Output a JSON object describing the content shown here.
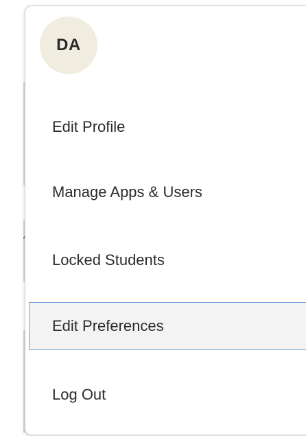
{
  "avatar": {
    "initials": "DA"
  },
  "menu": {
    "items": [
      {
        "label": "Edit Profile"
      },
      {
        "label": "Manage Apps & Users"
      },
      {
        "label": "Locked Students"
      },
      {
        "label": "Edit Preferences",
        "state": "focused"
      },
      {
        "label": "Log Out"
      }
    ]
  },
  "colors": {
    "avatar_bg": "#f1ece0",
    "focus_border": "#6a9fd4",
    "focus_bg": "#f3f3f3",
    "text": "#2b2b2b"
  }
}
